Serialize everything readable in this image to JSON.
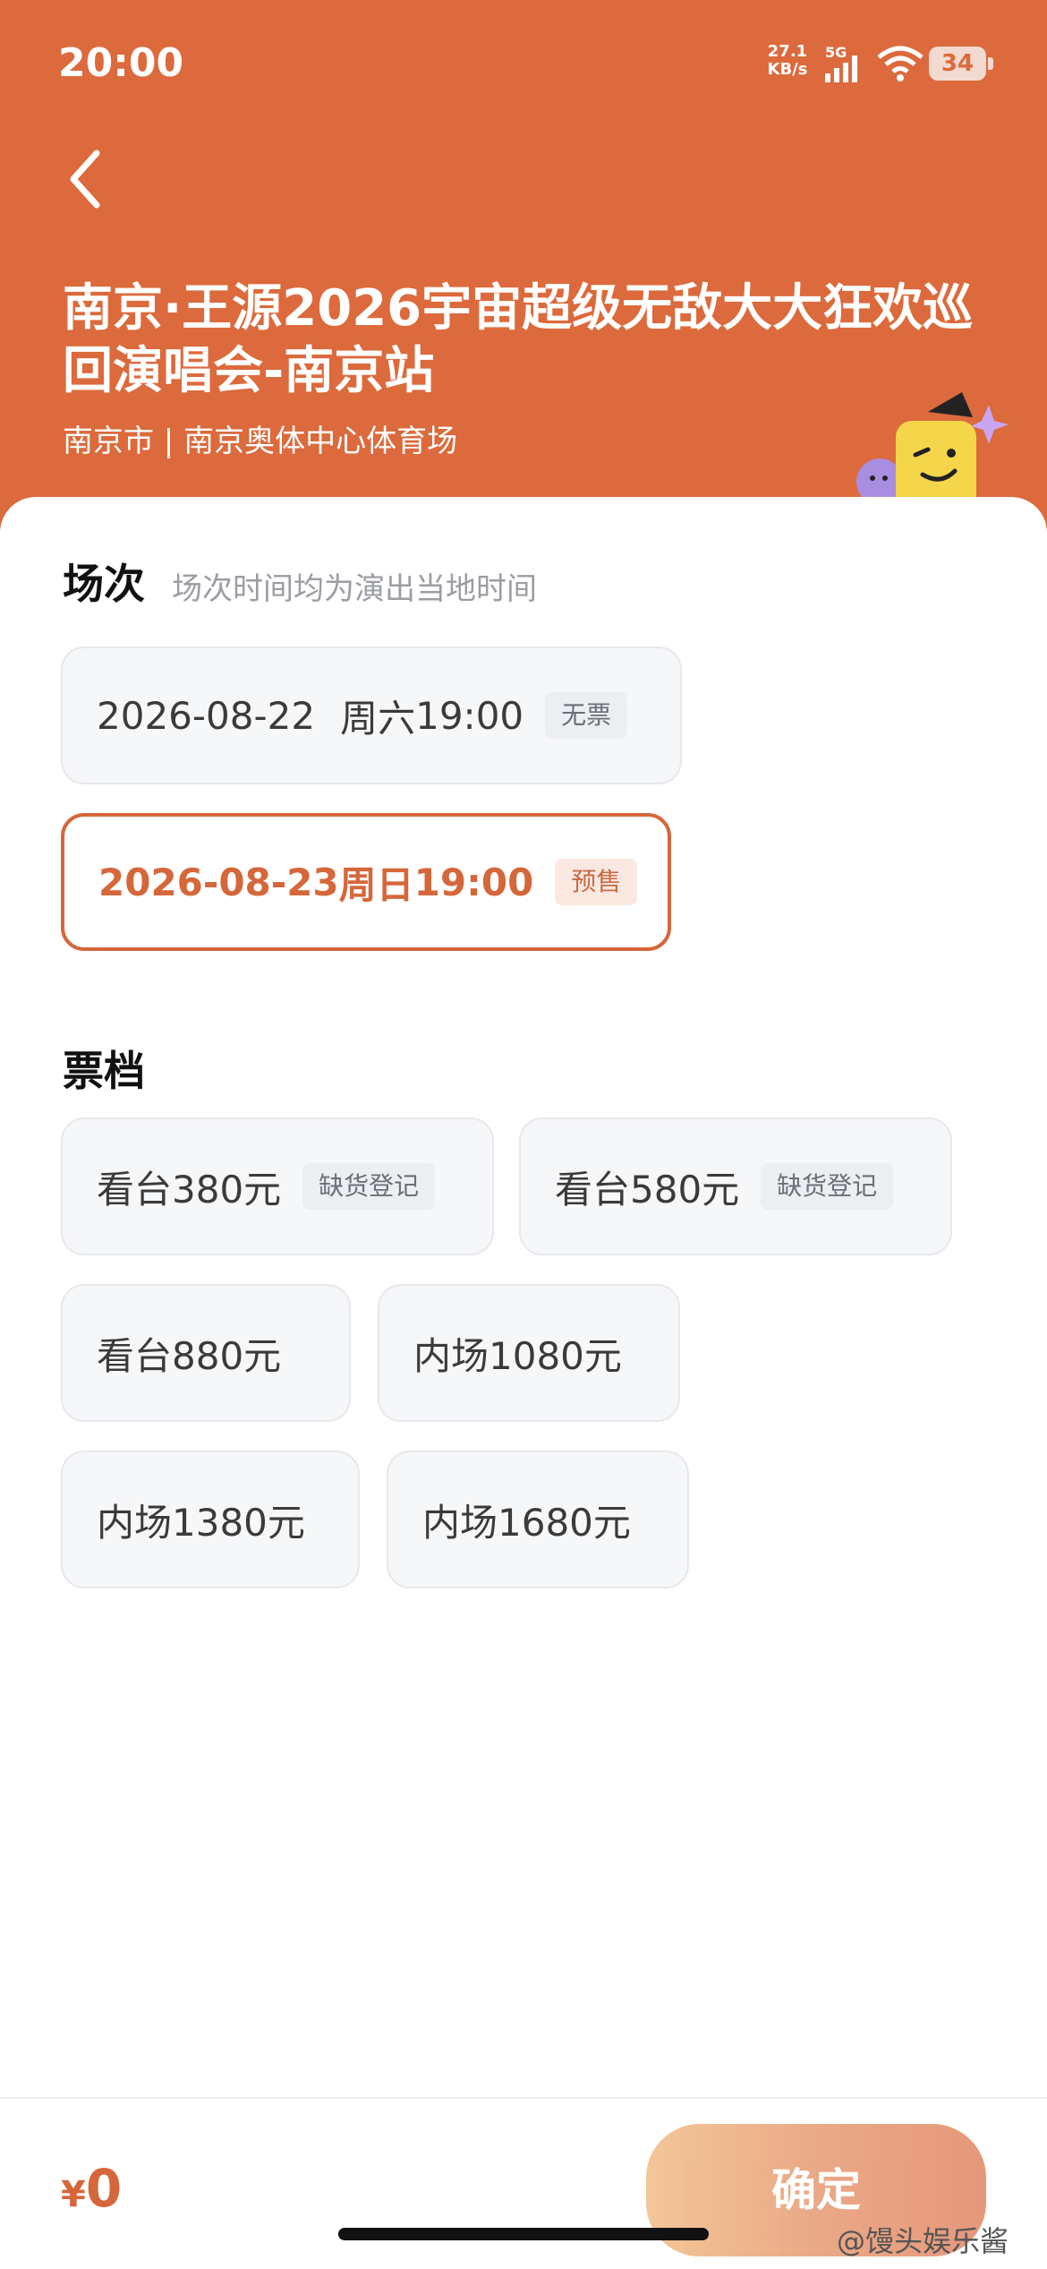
{
  "status_bar": {
    "time": "20:00",
    "net_speed_value": "27.1",
    "net_speed_unit": "KB/s",
    "network": "5G",
    "battery": "34"
  },
  "header": {
    "title": "南京·王源2026宇宙超级无敌大大狂欢巡回演唱会-南京站",
    "venue": "南京市 | 南京奥体中心体育场",
    "accent_color": "#dc6a3c"
  },
  "sessions": {
    "title": "场次",
    "note": "场次时间均为演出当地时间",
    "items": [
      {
        "date": "2026-08-22",
        "day": "周六",
        "time": "19:00",
        "tag": "无票"
      },
      {
        "date": "2026-08-23",
        "day": "周日",
        "time": "19:00",
        "tag": "预售"
      }
    ]
  },
  "tickets": {
    "title": "票档",
    "items": [
      {
        "label": "看台380元",
        "tag": "缺货登记"
      },
      {
        "label": "看台580元",
        "tag": "缺货登记"
      },
      {
        "label": "看台880元"
      },
      {
        "label": "内场1080元"
      },
      {
        "label": "内场1380元"
      },
      {
        "label": "内场1680元"
      }
    ]
  },
  "footer": {
    "currency": "¥",
    "total": "0",
    "confirm_label": "确定"
  },
  "watermark": "@馒头娱乐酱"
}
